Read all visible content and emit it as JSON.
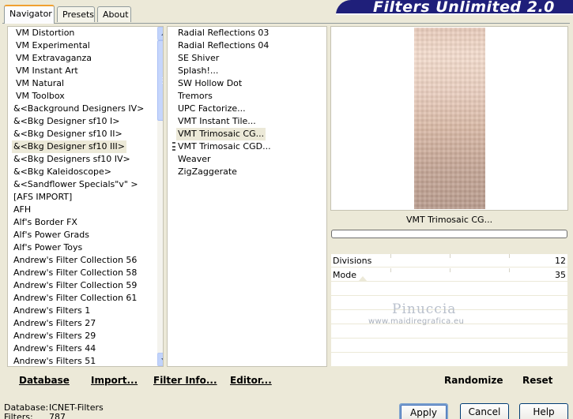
{
  "tabs": [
    {
      "label": "Navigator",
      "active": true
    },
    {
      "label": "Presets",
      "active": false
    },
    {
      "label": "About",
      "active": false
    }
  ],
  "banner": {
    "title": "Filters Unlimited 2.0",
    "color": "#1f1f7a"
  },
  "categories": {
    "selected": "&<Bkg Designer sf10 III>",
    "items": [
      "VM Distortion",
      "VM Experimental",
      "VM Extravaganza",
      "VM Instant Art",
      "VM Natural",
      "VM Toolbox",
      "&<Background Designers IV>",
      "&<Bkg Designer sf10 I>",
      "&<Bkg Designer sf10 II>",
      "&<Bkg Designer sf10 III>",
      "&<Bkg Designers sf10 IV>",
      "&<Bkg Kaleidoscope>",
      "&<Sandflower Specials\"v\" >",
      "[AFS IMPORT]",
      "AFH",
      "Alf's Border FX",
      "Alf's Power Grads",
      "Alf's Power Toys",
      "Andrew's Filter Collection 56",
      "Andrew's Filter Collection 58",
      "Andrew's Filter Collection 59",
      "Andrew's Filter Collection 61",
      "Andrew's Filters 1",
      "Andrew's Filters 27",
      "Andrew's Filters 29",
      "Andrew's Filters 44",
      "Andrew's Filters 51"
    ]
  },
  "filters": {
    "selected": "VMT Trimosaic CG...",
    "items": [
      "Radial Reflections 03",
      "Radial Reflections 04",
      "SE Shiver",
      "Splash!...",
      "SW Hollow Dot",
      "Tremors",
      "UPC Factorize...",
      "VMT Instant Tile...",
      "VMT Trimosaic CG...",
      "VMT Trimosaic CGD...",
      "Weaver",
      "ZigZaggerate"
    ]
  },
  "preview": {
    "filter_name": "VMT Trimosaic CG...",
    "progress": 0
  },
  "params": [
    {
      "label": "Divisions",
      "value": "12"
    },
    {
      "label": "Mode",
      "value": "35"
    }
  ],
  "watermark": {
    "name": "Pinuccia",
    "url": "www.maidiregrafica.eu"
  },
  "bottom_links": {
    "database": "Database",
    "import": "Import...",
    "filter_info": "Filter Info...",
    "editor": "Editor...",
    "randomize": "Randomize",
    "reset": "Reset"
  },
  "status": {
    "database_label": "Database:",
    "database_value": "ICNET-Filters",
    "filters_label": "Filters:",
    "filters_value": "787"
  },
  "dialog_buttons": {
    "apply": "Apply",
    "cancel": "Cancel",
    "help": "Help"
  }
}
